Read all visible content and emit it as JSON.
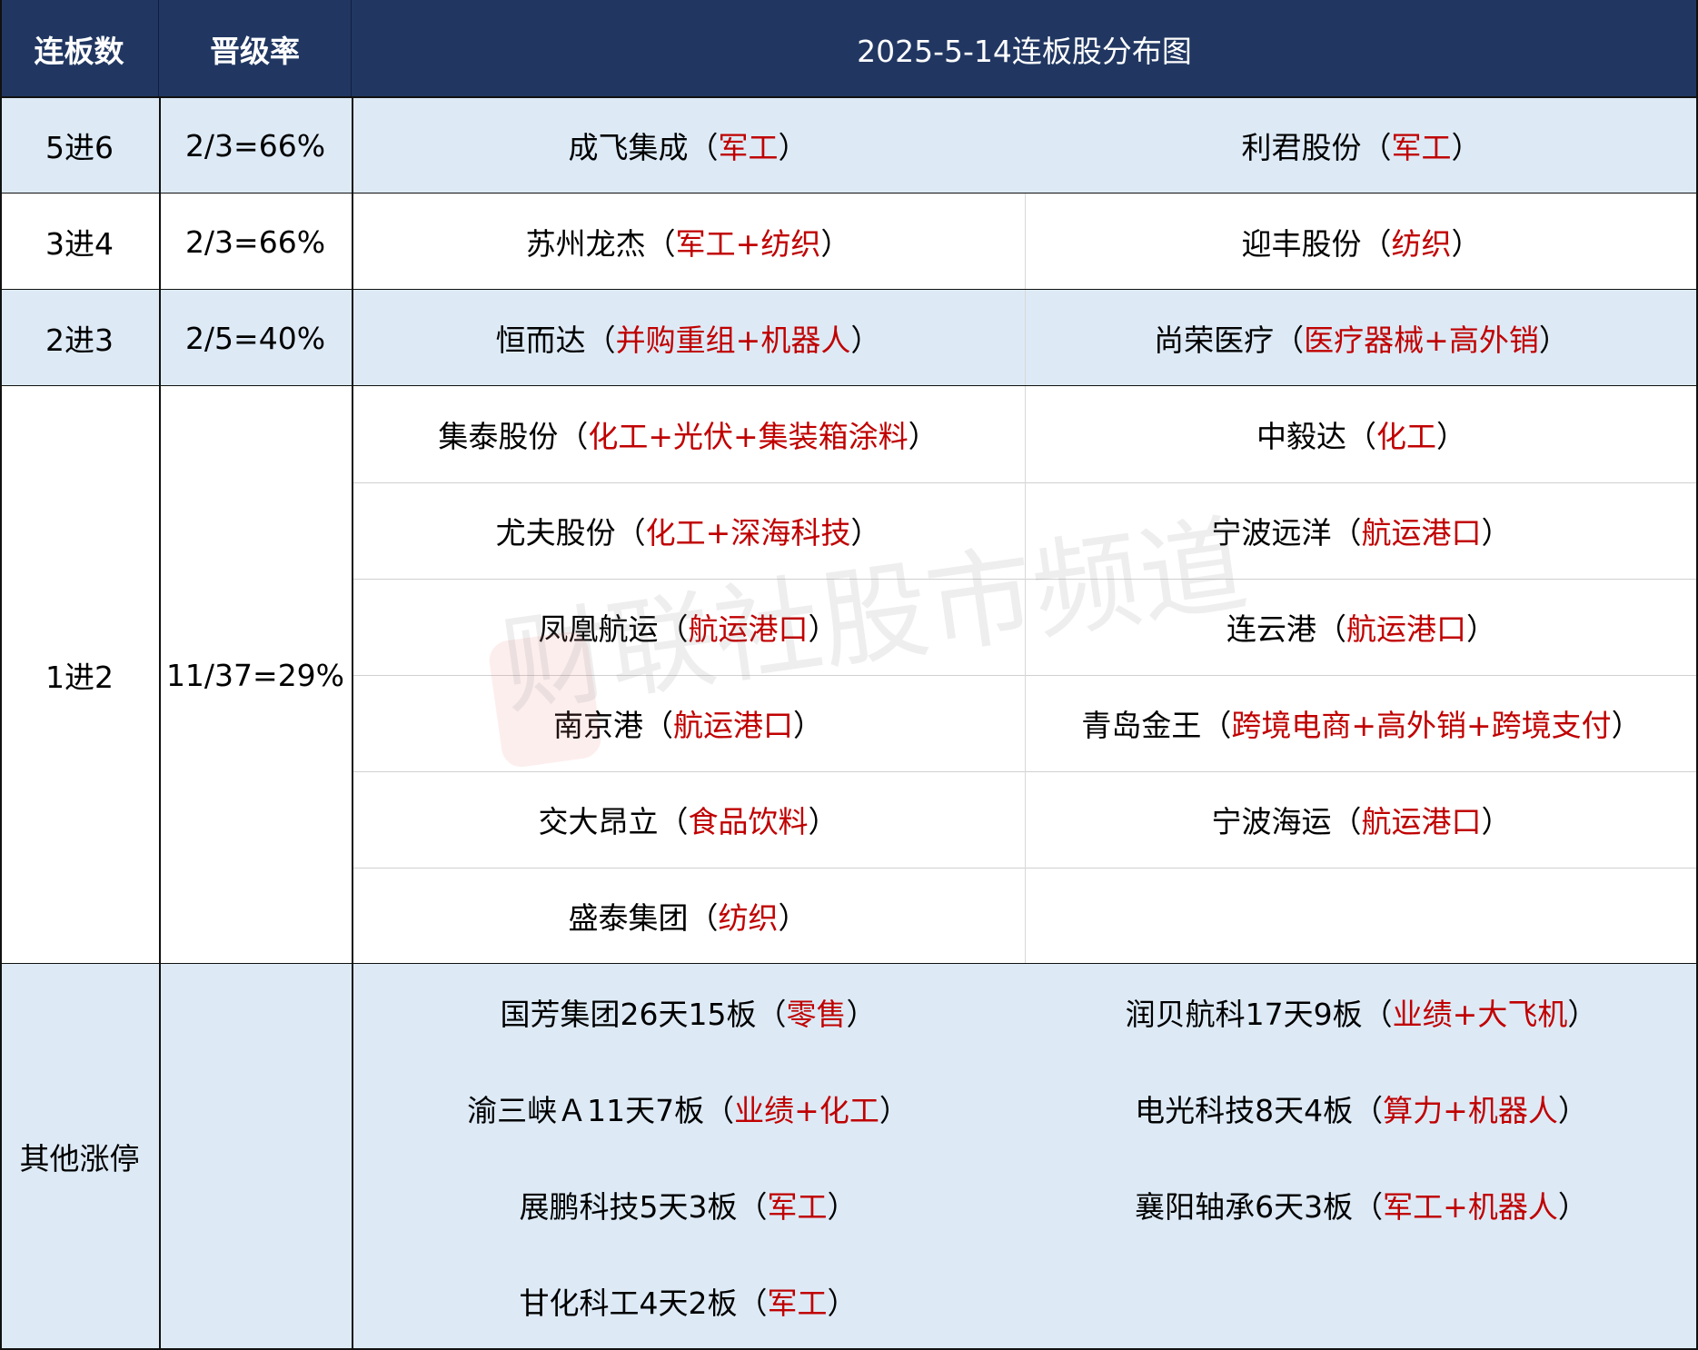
{
  "header": {
    "col1": "连板数",
    "col2": "晋级率",
    "title": "2025-5-14连板股分布图"
  },
  "colors": {
    "header_bg": "#213762",
    "row_blue": "#ddeaf6",
    "tag_red": "#c00000"
  },
  "groups": [
    {
      "label": "5进6",
      "rate": "2/3=66%",
      "bg": "blue",
      "lines": false,
      "stocks": [
        {
          "name": "成飞集成",
          "tag": "军工"
        },
        {
          "name": "利君股份",
          "tag": "军工"
        }
      ]
    },
    {
      "label": "3进4",
      "rate": "2/3=66%",
      "bg": "white",
      "lines": true,
      "stocks": [
        {
          "name": "苏州龙杰",
          "tag": "军工+纺织"
        },
        {
          "name": "迎丰股份",
          "tag": "纺织"
        }
      ]
    },
    {
      "label": "2进3",
      "rate": "2/5=40%",
      "bg": "blue",
      "lines": true,
      "stocks": [
        {
          "name": "恒而达",
          "tag": "并购重组+机器人"
        },
        {
          "name": "尚荣医疗",
          "tag": "医疗器械+高外销"
        }
      ]
    },
    {
      "label": "1进2",
      "rate": "11/37=29%",
      "bg": "white",
      "lines": true,
      "stocks": [
        {
          "name": "集泰股份",
          "tag": "化工+光伏+集装箱涂料"
        },
        {
          "name": "中毅达",
          "tag": "化工"
        },
        {
          "name": "尤夫股份",
          "tag": "化工+深海科技"
        },
        {
          "name": "宁波远洋",
          "tag": "航运港口"
        },
        {
          "name": "凤凰航运",
          "tag": "航运港口"
        },
        {
          "name": "连云港",
          "tag": "航运港口"
        },
        {
          "name": "南京港",
          "tag": "航运港口"
        },
        {
          "name": "青岛金王",
          "tag": "跨境电商+高外销+跨境支付"
        },
        {
          "name": "交大昂立",
          "tag": "食品饮料"
        },
        {
          "name": "宁波海运",
          "tag": "航运港口"
        },
        {
          "name": "盛泰集团",
          "tag": "纺织"
        }
      ]
    },
    {
      "label": "其他涨停",
      "rate": "",
      "bg": "blue",
      "lines": false,
      "stocks": [
        {
          "name": "国芳集团26天15板",
          "tag": "零售"
        },
        {
          "name": "润贝航科17天9板",
          "tag": "业绩+大飞机"
        },
        {
          "name": "渝三峡Ａ11天7板",
          "tag": "业绩+化工"
        },
        {
          "name": "电光科技8天4板",
          "tag": "算力+机器人"
        },
        {
          "name": "展鹏科技5天3板",
          "tag": "军工"
        },
        {
          "name": "襄阳轴承6天3板",
          "tag": "军工+机器人"
        },
        {
          "name": "甘化科工4天2板",
          "tag": "军工"
        }
      ]
    }
  ],
  "watermark": "财联社股市频道"
}
